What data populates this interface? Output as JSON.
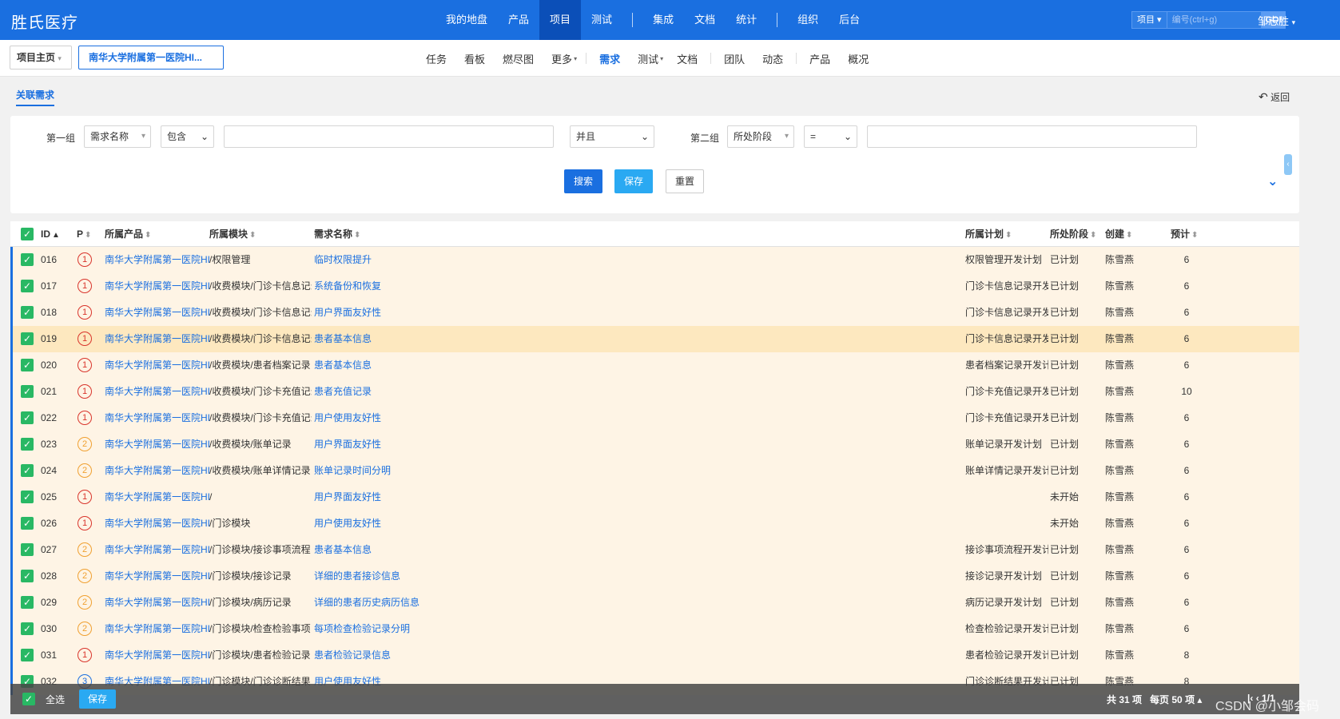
{
  "app": {
    "brand": "胜氏医疗"
  },
  "main_nav": [
    {
      "label": "我的地盘",
      "active": false
    },
    {
      "label": "产品",
      "active": false
    },
    {
      "label": "项目",
      "active": true
    },
    {
      "label": "测试",
      "active": false
    },
    {
      "sep": true
    },
    {
      "label": "集成",
      "active": false
    },
    {
      "label": "文档",
      "active": false
    },
    {
      "label": "统计",
      "active": false
    },
    {
      "sep": true
    },
    {
      "label": "组织",
      "active": false
    },
    {
      "label": "后台",
      "active": false
    }
  ],
  "search": {
    "type": "项目",
    "placeholder": "编号(ctrl+g)",
    "go": "GO!"
  },
  "user": "邹志胜",
  "breadcrumb": {
    "home": "项目主页",
    "project": "南华大学附属第一医院HI..."
  },
  "sub_nav": [
    "任务",
    "看板",
    "燃尽图",
    "更多",
    "|",
    "需求",
    "测试",
    "文档",
    "|",
    "团队",
    "动态",
    "|",
    "产品",
    "概况"
  ],
  "sub_nav_active": "需求",
  "page": {
    "tab": "关联需求",
    "back": "返回"
  },
  "filter": {
    "group1_label": "第一组",
    "group1_field": "需求名称",
    "group1_op": "包含",
    "group1_value": "",
    "logic": "并且",
    "group2_label": "第二组",
    "group2_field": "所处阶段",
    "group2_op": "=",
    "group2_value": "",
    "search_btn": "搜索",
    "save_btn": "保存",
    "reset_btn": "重置"
  },
  "table": {
    "columns": [
      "ID",
      "P",
      "所属产品",
      "所属模块",
      "需求名称",
      "所属计划",
      "所处阶段",
      "创建",
      "预计"
    ],
    "rows": [
      {
        "id": "016",
        "p": 1,
        "product": "南华大学附属第一医院HI",
        "module": "/权限管理",
        "name": "临时权限提升",
        "plan": "权限管理开发计划",
        "stage": "已计划",
        "creator": "陈雪燕",
        "est": "6"
      },
      {
        "id": "017",
        "p": 1,
        "product": "南华大学附属第一医院HI",
        "module": "/收费模块/门诊卡信息记录",
        "name": "系统备份和恢复",
        "plan": "门诊卡信息记录开发",
        "stage": "已计划",
        "creator": "陈雪燕",
        "est": "6"
      },
      {
        "id": "018",
        "p": 1,
        "product": "南华大学附属第一医院HI",
        "module": "/收费模块/门诊卡信息记录",
        "name": "用户界面友好性",
        "plan": "门诊卡信息记录开发",
        "stage": "已计划",
        "creator": "陈雪燕",
        "est": "6"
      },
      {
        "id": "019",
        "p": 1,
        "product": "南华大学附属第一医院HI",
        "module": "/收费模块/门诊卡信息记录",
        "name": "患者基本信息",
        "plan": "门诊卡信息记录开发",
        "stage": "已计划",
        "creator": "陈雪燕",
        "est": "6"
      },
      {
        "id": "020",
        "p": 1,
        "product": "南华大学附属第一医院HI",
        "module": "/收费模块/患者档案记录",
        "name": "患者基本信息",
        "plan": "患者档案记录开发计",
        "stage": "已计划",
        "creator": "陈雪燕",
        "est": "6"
      },
      {
        "id": "021",
        "p": 1,
        "product": "南华大学附属第一医院HI",
        "module": "/收费模块/门诊卡充值记录",
        "name": "患者充值记录",
        "plan": "门诊卡充值记录开发",
        "stage": "已计划",
        "creator": "陈雪燕",
        "est": "10"
      },
      {
        "id": "022",
        "p": 1,
        "product": "南华大学附属第一医院HI",
        "module": "/收费模块/门诊卡充值记录",
        "name": "用户使用友好性",
        "plan": "门诊卡充值记录开发",
        "stage": "已计划",
        "creator": "陈雪燕",
        "est": "6"
      },
      {
        "id": "023",
        "p": 2,
        "product": "南华大学附属第一医院HI",
        "module": "/收费模块/账单记录",
        "name": "用户界面友好性",
        "plan": "账单记录开发计划",
        "stage": "已计划",
        "creator": "陈雪燕",
        "est": "6"
      },
      {
        "id": "024",
        "p": 2,
        "product": "南华大学附属第一医院HI",
        "module": "/收费模块/账单详情记录",
        "name": "账单记录时间分明",
        "plan": "账单详情记录开发计",
        "stage": "已计划",
        "creator": "陈雪燕",
        "est": "6"
      },
      {
        "id": "025",
        "p": 1,
        "product": "南华大学附属第一医院HI",
        "module": "/",
        "name": "用户界面友好性",
        "plan": "",
        "stage": "未开始",
        "creator": "陈雪燕",
        "est": "6"
      },
      {
        "id": "026",
        "p": 1,
        "product": "南华大学附属第一医院HI",
        "module": "/门诊模块",
        "name": "用户使用友好性",
        "plan": "",
        "stage": "未开始",
        "creator": "陈雪燕",
        "est": "6"
      },
      {
        "id": "027",
        "p": 2,
        "product": "南华大学附属第一医院HI",
        "module": "/门诊模块/接诊事项流程",
        "name": "患者基本信息",
        "plan": "接诊事项流程开发计",
        "stage": "已计划",
        "creator": "陈雪燕",
        "est": "6"
      },
      {
        "id": "028",
        "p": 2,
        "product": "南华大学附属第一医院HI",
        "module": "/门诊模块/接诊记录",
        "name": "详细的患者接诊信息",
        "plan": "接诊记录开发计划",
        "stage": "已计划",
        "creator": "陈雪燕",
        "est": "6"
      },
      {
        "id": "029",
        "p": 2,
        "product": "南华大学附属第一医院HI",
        "module": "/门诊模块/病历记录",
        "name": "详细的患者历史病历信息",
        "plan": "病历记录开发计划",
        "stage": "已计划",
        "creator": "陈雪燕",
        "est": "6"
      },
      {
        "id": "030",
        "p": 2,
        "product": "南华大学附属第一医院HI",
        "module": "/门诊模块/检查检验事项",
        "name": "每项检查检验记录分明",
        "plan": "检查检验记录开发计",
        "stage": "已计划",
        "creator": "陈雪燕",
        "est": "6"
      },
      {
        "id": "031",
        "p": 1,
        "product": "南华大学附属第一医院HI",
        "module": "/门诊模块/患者检验记录",
        "name": "患者检验记录信息",
        "plan": "患者检验记录开发计",
        "stage": "已计划",
        "creator": "陈雪燕",
        "est": "8"
      },
      {
        "id": "032",
        "p": 3,
        "product": "南华大学附属第一医院HI",
        "module": "/门诊模块/门诊诊断结果",
        "name": "用户使用友好性",
        "plan": "门诊诊断结果开发计",
        "stage": "已计划",
        "creator": "陈雪燕",
        "est": "8"
      }
    ]
  },
  "footer": {
    "select_all": "全选",
    "save": "保存",
    "total": "共 31 项",
    "per_page": "每页 50 项",
    "page": "1/1"
  },
  "watermark": "CSDN @小邹会码"
}
